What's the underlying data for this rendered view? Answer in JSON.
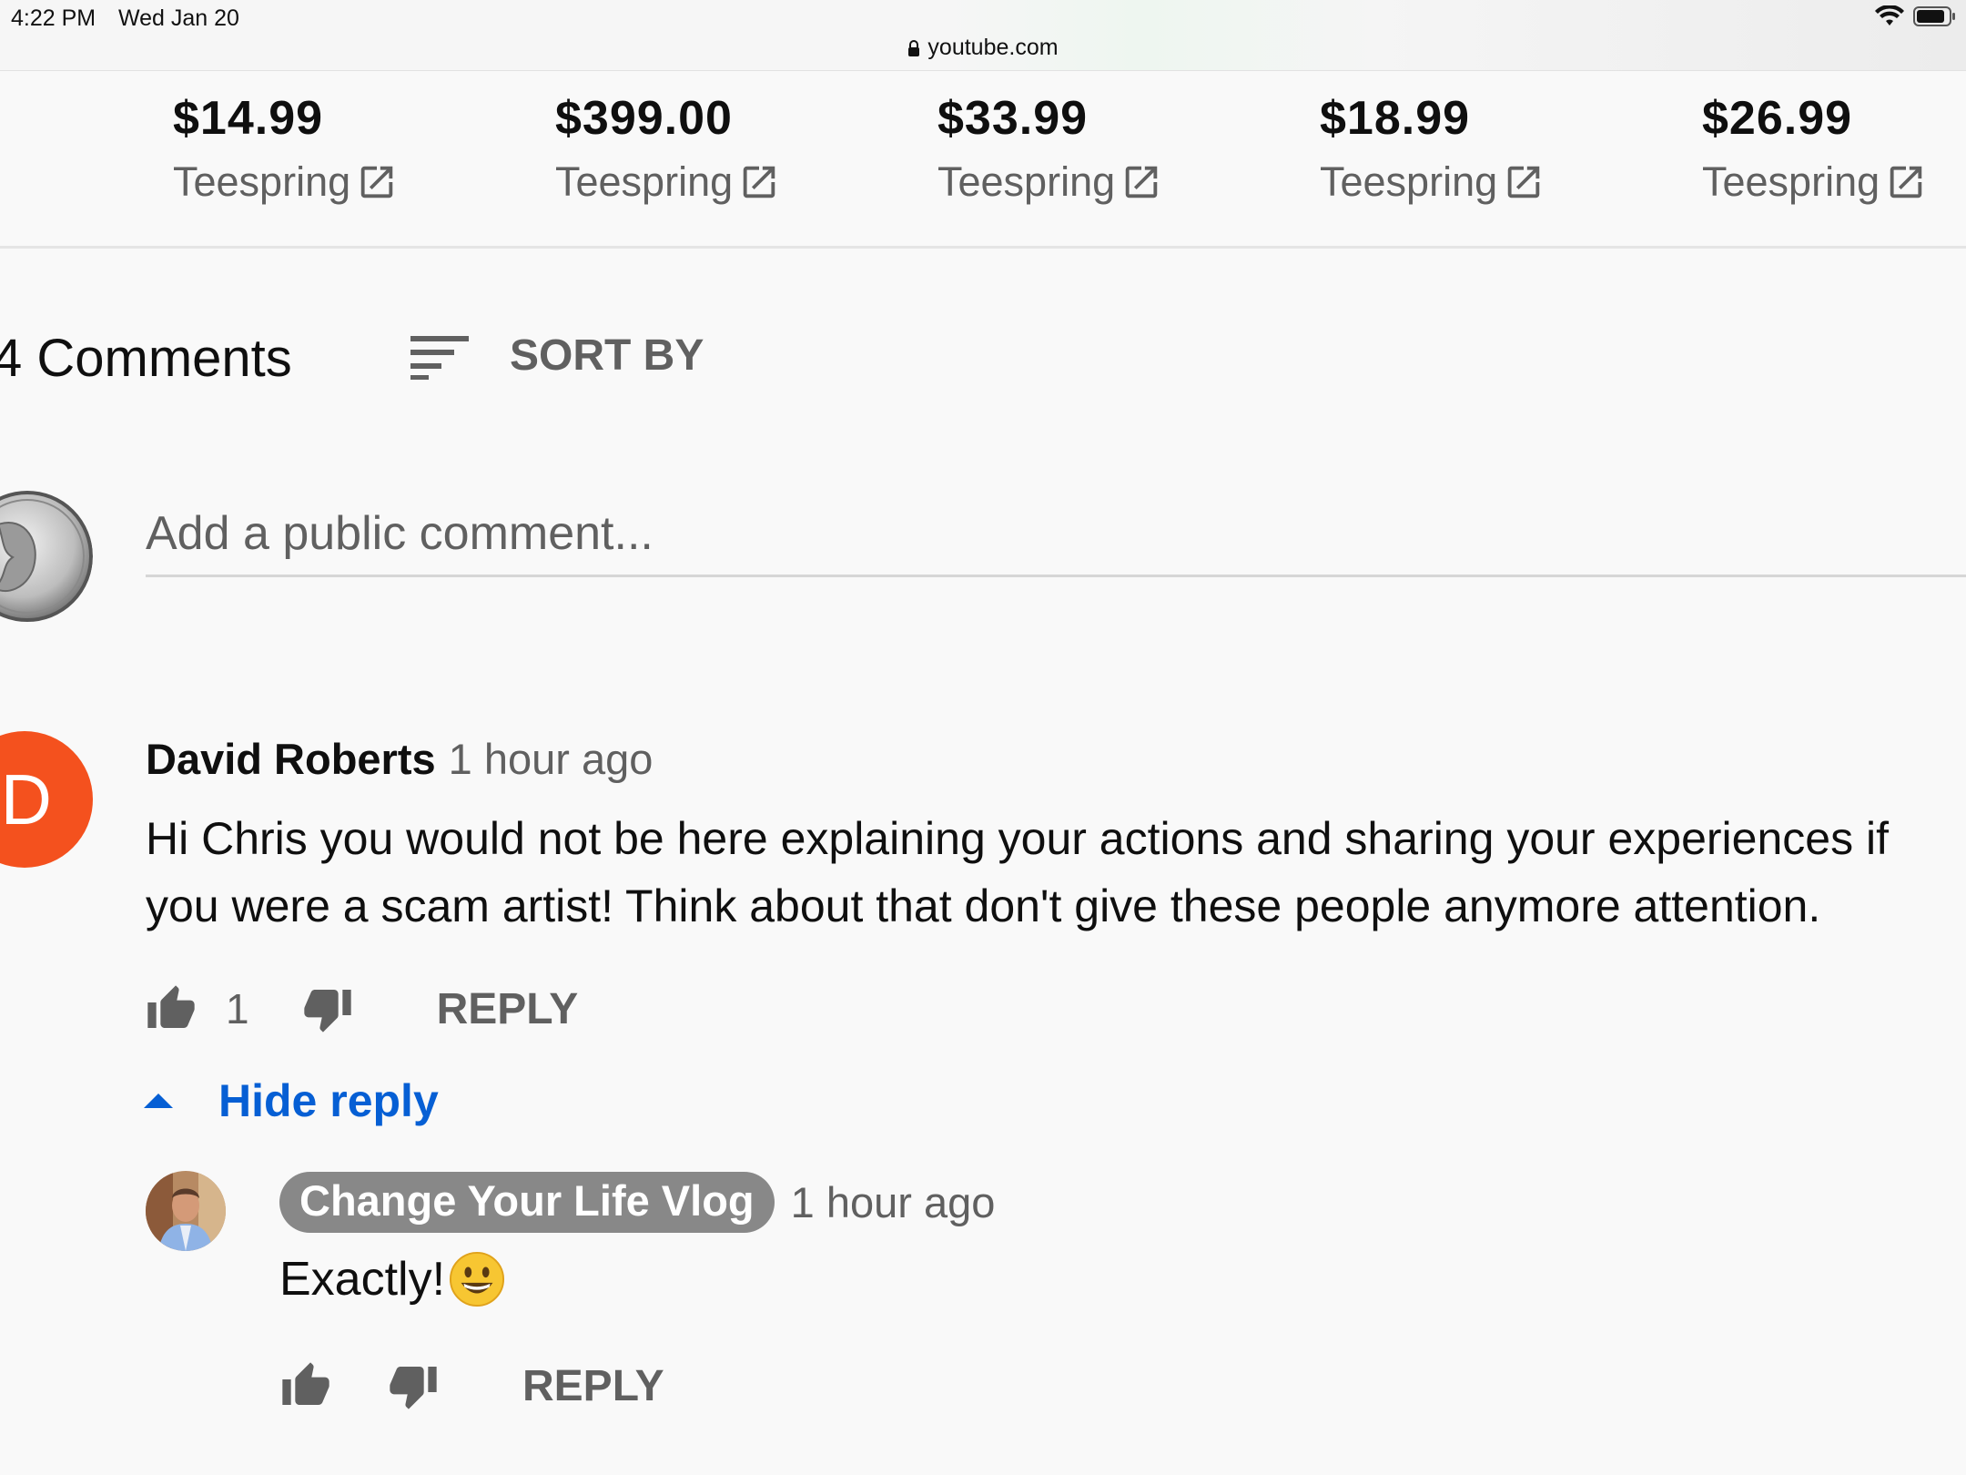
{
  "status_bar": {
    "time": "4:22 PM",
    "date": "Wed Jan 20"
  },
  "browser": {
    "url": "youtube.com"
  },
  "merch": [
    {
      "price": "$14.99",
      "store": "Teespring"
    },
    {
      "price": "$399.00",
      "store": "Teespring"
    },
    {
      "price": "$33.99",
      "store": "Teespring"
    },
    {
      "price": "$18.99",
      "store": "Teespring"
    },
    {
      "price": "$26.99",
      "store": "Teespring"
    }
  ],
  "comments": {
    "count_label": "4 Comments",
    "sort_label": "SORT BY",
    "add_placeholder": "Add a public comment...",
    "thread": {
      "avatar_letter": "D",
      "avatar_color": "#f4511e",
      "author": "David Roberts",
      "time": "1 hour ago",
      "text": "Hi Chris you would not be here explaining your actions  and sharing your experiences if you were a scam artist! Think about that don't give these people anymore attention.",
      "likes": "1",
      "reply_label": "REPLY",
      "hide_reply_label": "Hide reply",
      "reply": {
        "author": "Change Your Life Vlog",
        "time": "1 hour ago",
        "text": "Exactly!",
        "reply_label": "REPLY"
      }
    }
  },
  "colors": {
    "link_blue": "#065fd4",
    "secondary_text": "#606060",
    "channel_chip": "#888888"
  },
  "icons": [
    "lock-icon",
    "wifi-icon",
    "battery-icon",
    "external-link-icon",
    "sort-icon",
    "like-icon",
    "dislike-icon",
    "caret-up-icon",
    "grinning-emoji-icon"
  ]
}
